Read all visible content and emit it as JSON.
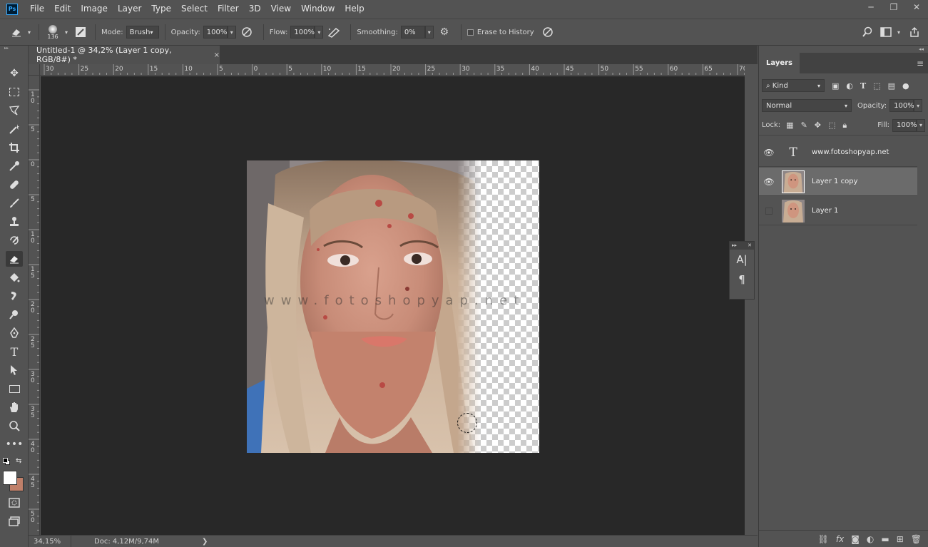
{
  "app": {
    "logo": "Ps"
  },
  "menu": [
    "File",
    "Edit",
    "Image",
    "Layer",
    "Type",
    "Select",
    "Filter",
    "3D",
    "View",
    "Window",
    "Help"
  ],
  "window_controls": {
    "minimize": "─",
    "restore": "❐",
    "close": "✕"
  },
  "options": {
    "brush_size": "136",
    "mode_label": "Mode:",
    "mode_value": "Brush",
    "opacity_label": "Opacity:",
    "opacity_value": "100%",
    "flow_label": "Flow:",
    "flow_value": "100%",
    "smoothing_label": "Smoothing:",
    "smoothing_value": "0%",
    "erase_history_label": "Erase to History"
  },
  "document_tab": {
    "title": "Untitled-1 @ 34,2% (Layer 1 copy, RGB/8#) *",
    "close": "×"
  },
  "ruler_top_labels": [
    "30",
    "25",
    "20",
    "15",
    "10",
    "5",
    "0",
    "5",
    "10",
    "15",
    "20",
    "25",
    "30",
    "35",
    "40",
    "45",
    "50",
    "55",
    "60",
    "65",
    "70"
  ],
  "ruler_left_labels": [
    "1 0",
    "5",
    "0",
    "5",
    "1 0",
    "1 5",
    "2 0",
    "2 5",
    "3 0",
    "3 5",
    "4 0",
    "4 5",
    "5 0"
  ],
  "canvas": {
    "watermark": "www.fotoshopyap.net"
  },
  "status": {
    "zoom": "34,15%",
    "doc": "Doc: 4,12M/9,74M",
    "arrow": "❯"
  },
  "float_panel": {
    "char_icon": "A|",
    "para_icon": "¶"
  },
  "layers_panel": {
    "tab_label": "Layers",
    "filter_kind": "Kind",
    "blend_mode": "Normal",
    "opacity_label": "Opacity:",
    "opacity_value": "100%",
    "lock_label": "Lock:",
    "fill_label": "Fill:",
    "fill_value": "100%",
    "layers": [
      {
        "name": "www.fotoshopyap.net",
        "type": "text",
        "visible": true,
        "selected": false
      },
      {
        "name": "Layer 1 copy",
        "type": "image",
        "visible": true,
        "selected": true
      },
      {
        "name": "Layer 1",
        "type": "image",
        "visible": false,
        "selected": false
      }
    ]
  },
  "colors": {
    "foreground": "#ffffff",
    "background": "#c0806a",
    "accent": "#31a8ff"
  }
}
